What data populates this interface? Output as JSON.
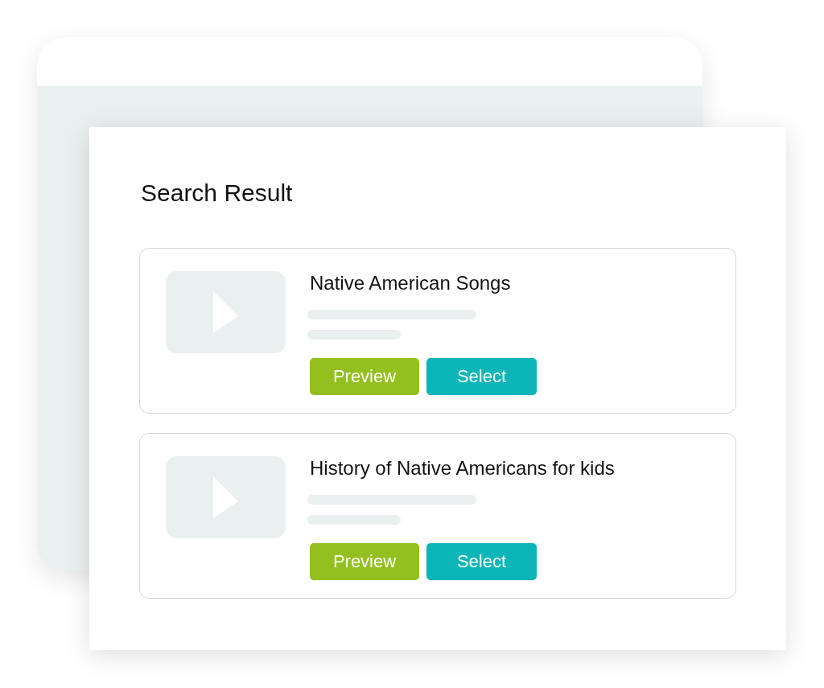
{
  "title": "Search Result",
  "results": [
    {
      "title": "Native American Songs",
      "buttons": [
        {
          "label": "Preview",
          "kind": "preview"
        },
        {
          "label": "Select",
          "kind": "select"
        }
      ]
    },
    {
      "title": "History of Native Americans for kids",
      "buttons": [
        {
          "label": "Preview",
          "kind": "preview"
        },
        {
          "label": "Select",
          "kind": "select"
        }
      ]
    }
  ]
}
